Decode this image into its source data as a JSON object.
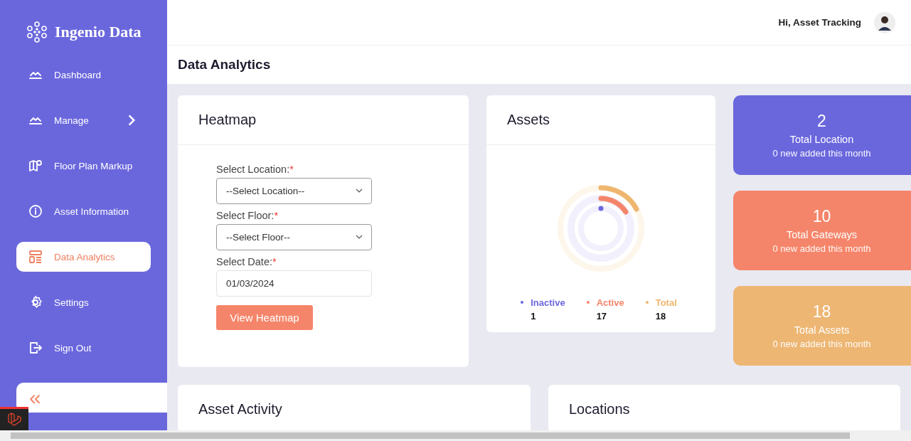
{
  "brand": {
    "name": "Ingenio Data"
  },
  "sidebar": {
    "items": [
      {
        "label": "Dashboard",
        "selected": false,
        "has_submenu": false
      },
      {
        "label": "Manage",
        "selected": false,
        "has_submenu": true
      },
      {
        "label": "Floor Plan Markup",
        "selected": false,
        "has_submenu": false
      },
      {
        "label": "Asset Information",
        "selected": false,
        "has_submenu": false
      },
      {
        "label": "Data Analytics",
        "selected": true,
        "has_submenu": false
      },
      {
        "label": "Settings",
        "selected": false,
        "has_submenu": false
      },
      {
        "label": "Sign Out",
        "selected": false,
        "has_submenu": false
      }
    ],
    "collapse": {
      "label": "«"
    }
  },
  "header": {
    "greeting": "Hi, Asset Tracking"
  },
  "page_title": "Data Analytics",
  "heatmap": {
    "title": "Heatmap",
    "fields": [
      {
        "kind": "select",
        "label": "Select Location:",
        "required_mark": "*",
        "value": "--Select Location--"
      },
      {
        "kind": "select",
        "label": "Select Floor:",
        "required_mark": "*",
        "value": "--Select Floor--"
      },
      {
        "kind": "date",
        "label": "Select Date:",
        "required_mark": "*",
        "value": "01/03/2024"
      }
    ],
    "button": "View Heatmap"
  },
  "assets": {
    "title": "Assets",
    "legend": [
      {
        "label": "Inactive",
        "value": "1",
        "color": "#6c67dd"
      },
      {
        "label": "Active",
        "value": "17",
        "color": "#f5856a"
      },
      {
        "label": "Total",
        "value": "18",
        "color": "#efb66f"
      }
    ]
  },
  "stats": [
    {
      "value": "2",
      "label": "Total Location",
      "note": "0 new added this month",
      "color": "#6a67dd"
    },
    {
      "value": "10",
      "label": "Total Gateways",
      "note": "0 new added this month",
      "color": "#f5856a"
    },
    {
      "value": "18",
      "label": "Total Assets",
      "note": "0 new added this month",
      "color": "#edb673"
    }
  ],
  "bottom_cards": [
    {
      "title": "Asset Activity"
    },
    {
      "title": "Locations"
    }
  ]
}
